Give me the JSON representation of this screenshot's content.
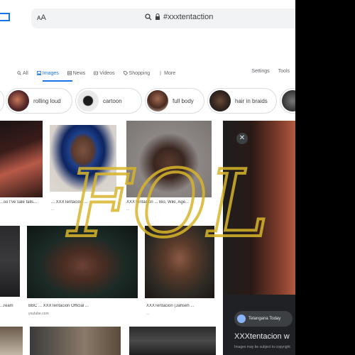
{
  "browser": {
    "text_size_button": "ᴀA",
    "address": "#xxxtentaction"
  },
  "tabs": [
    {
      "label": "All",
      "icon": "search-icon"
    },
    {
      "label": "Images",
      "icon": "image-icon",
      "active": true
    },
    {
      "label": "News",
      "icon": "news-icon"
    },
    {
      "label": "Videos",
      "icon": "video-icon"
    },
    {
      "label": "Shopping",
      "icon": "tag-icon"
    },
    {
      "label": "More",
      "icon": "more-icon"
    }
  ],
  "tools": [
    "Settings",
    "Tools"
  ],
  "chips": [
    "rolling loud",
    "cartoon",
    "full body",
    "hair in braids"
  ],
  "results": {
    "r1": {
      "caption": "...so I've sale falls...",
      "source": ""
    },
    "r2": {
      "caption": "... XXXTentacion ...",
      "source": "..."
    },
    "r3": {
      "caption": "XXXTentacion ... Bio, Wiki, Age...",
      "source": "..."
    },
    "r4": {
      "caption": "...ream",
      "source": "..."
    },
    "r5": {
      "caption": "BBC ... XXXTentacion Official ...",
      "source": "youtube.com"
    },
    "r6": {
      "caption": "XXXTentacion (Jahseh ...",
      "source": "..."
    }
  },
  "panel": {
    "source": "Telangana Today",
    "title": "XXXtentacion w",
    "subtitle": "Images may be subject to copyright."
  },
  "overlay_text": "FOL",
  "colors": {
    "accent": "#1a73e8",
    "scribble": "#d8b52a",
    "panel_bg": "#202124"
  }
}
